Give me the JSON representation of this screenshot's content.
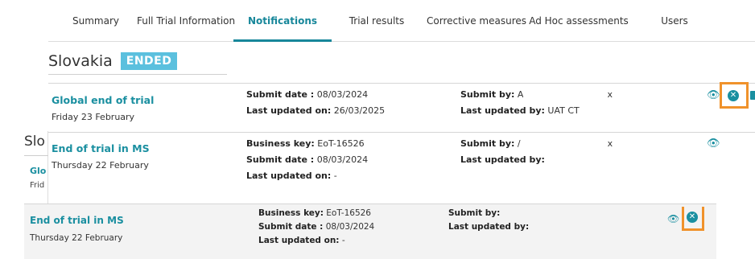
{
  "tabs": [
    {
      "label": "Summary"
    },
    {
      "label": "Full Trial Information"
    },
    {
      "label": "Notifications"
    },
    {
      "label": "Trial results"
    },
    {
      "label": "Corrective measures"
    },
    {
      "label": "Ad Hoc assessments"
    },
    {
      "label": "Users"
    }
  ],
  "active_tab": "Notifications",
  "country": {
    "name": "Slovakia",
    "status": "ENDED"
  },
  "notifications": [
    {
      "title": "Global end of trial",
      "date": "Friday 23 February",
      "col2": [
        {
          "label": "Submit date :",
          "value": " 08/03/2024"
        },
        {
          "label": "Last updated on:",
          "value": " 26/03/2025"
        }
      ],
      "col3": [
        {
          "label": "Submit by:",
          "value": " A",
          "tail": "x"
        },
        {
          "label": "Last updated by:",
          "value": " UAT CT"
        }
      ]
    },
    {
      "title": "End of trial in MS",
      "date": "Thursday 22 February",
      "col2": [
        {
          "label": "Business key:",
          "value": " EoT-16526"
        },
        {
          "label": "Submit date :",
          "value": " 08/03/2024"
        },
        {
          "label": "Last updated on:",
          "value": " -"
        }
      ],
      "col3": [
        {
          "label": "Submit by:",
          "value": " /",
          "tail": "x"
        },
        {
          "label": "Last updated by:",
          "value": ""
        }
      ]
    }
  ],
  "background": {
    "country_partial": "Slo",
    "notif_partial_title": "Glo",
    "notif_partial_date": "Frid",
    "row": {
      "title": "End of trial in MS",
      "date": "Thursday 22 February",
      "col2": [
        {
          "label": "Business key:",
          "value": " EoT-16526"
        },
        {
          "label": "Submit date :",
          "value": " 08/03/2024"
        },
        {
          "label": "Last updated on:",
          "value": " -"
        }
      ],
      "col3": [
        {
          "label": "Submit by:",
          "value": ""
        },
        {
          "label": "Last updated by:",
          "value": ""
        }
      ]
    }
  },
  "icons": {
    "view": "eye-icon",
    "withdraw": "close-circle-icon",
    "document": "document-icon"
  },
  "colors": {
    "accent": "#1a8fa0",
    "badge": "#5bc0de",
    "highlight": "#f0922b"
  }
}
